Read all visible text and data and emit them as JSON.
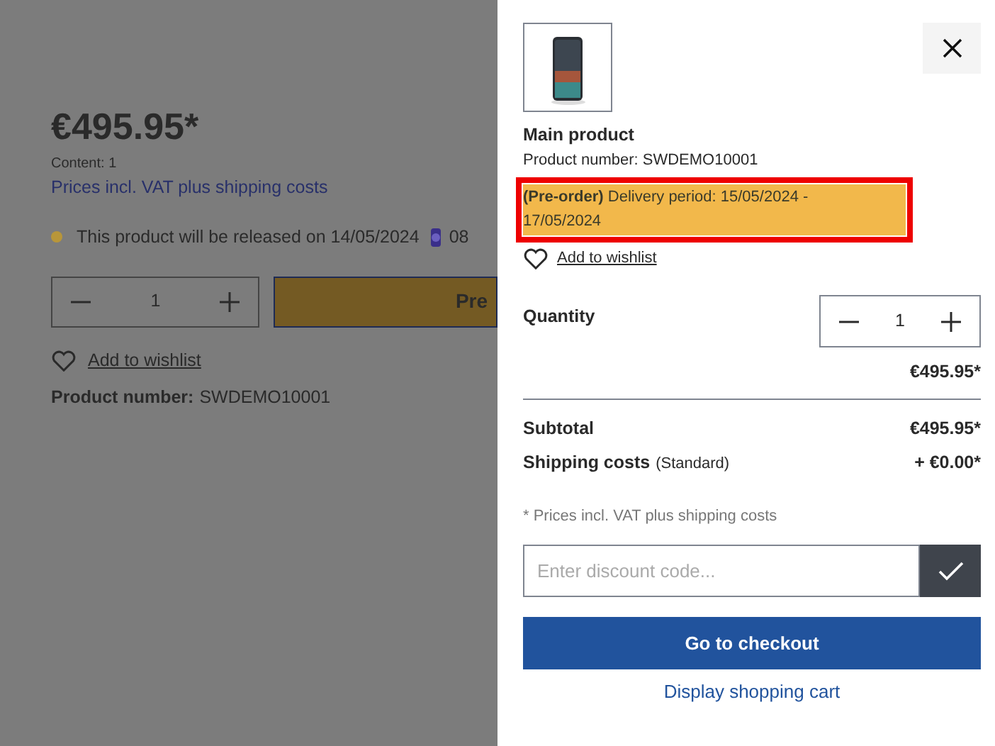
{
  "page": {
    "price": "€495.95*",
    "content": "Content: 1",
    "vat_note": "Prices incl. VAT plus shipping costs",
    "release": {
      "text": "This product will be released on 14/05/2024",
      "time": "08",
      "color": "#b8963a"
    },
    "quantity": "1",
    "buy_button": "Pre",
    "wishlist": "Add to wishlist",
    "product_number_label": "Product number:",
    "product_number": "SWDEMO10001"
  },
  "cart": {
    "product": {
      "kind": "picture",
      "name": "Main product",
      "number": "Product number: SWDEMO10001",
      "delivery": {
        "label": "(Pre-order)",
        "text": "Delivery period: 15/05/2024 - 17/05/2024",
        "highlighted": true
      },
      "wishlist": "Add to wishlist"
    },
    "quantity_label": "Quantity",
    "quantity": "1",
    "line_price": "€495.95*",
    "subtotal_label": "Subtotal",
    "subtotal": "€495.95*",
    "shipping_label": "Shipping costs",
    "shipping_method": "(Standard)",
    "shipping": "+ €0.00*",
    "vat_note": "* Prices incl. VAT plus shipping costs",
    "discount": {
      "placeholder": "Enter discount code..."
    },
    "checkout": "Go to checkout",
    "view_cart": "Display shopping cart"
  }
}
